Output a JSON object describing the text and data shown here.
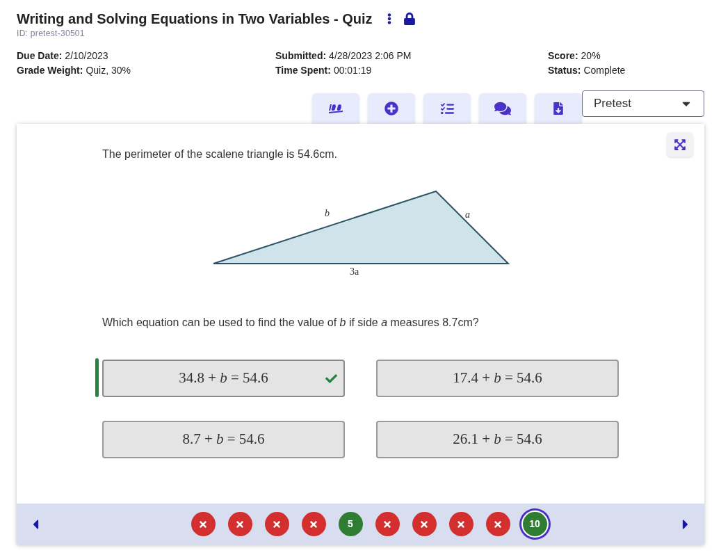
{
  "header": {
    "title": "Writing and Solving Equations in Two Variables - Quiz",
    "id": "ID: pretest-30501"
  },
  "info": [
    [
      {
        "label": "Due Date:",
        "value": "2/10/2023"
      },
      {
        "label": "Grade Weight:",
        "value": "Quiz, 30%"
      }
    ],
    [
      {
        "label": "Submitted:",
        "value": "4/28/2023 2:06 PM"
      },
      {
        "label": "Time Spent:",
        "value": "00:01:19"
      }
    ],
    [
      {
        "label": "Score:",
        "value": "20%"
      },
      {
        "label": "Status:",
        "value": "Complete"
      }
    ]
  ],
  "toolbar": [
    {
      "kind": "score"
    },
    {
      "kind": "add"
    },
    {
      "kind": "checklist"
    },
    {
      "kind": "comments"
    },
    {
      "kind": "download"
    }
  ],
  "dropdown": {
    "value": "Pretest"
  },
  "question": {
    "prompt": "The perimeter of the scalene triangle is 54.6cm.",
    "diagram_labels": {
      "left": "*b*",
      "right": "*a*",
      "base": "3a"
    },
    "ask": "Which equation can be used to find the value of *b* if side *a* measures 8.7cm?"
  },
  "choices": [
    {
      "text": "34.8 + *b* = 54.6",
      "selected": true,
      "correct": true
    },
    {
      "text": "17.4 + *b* = 54.6",
      "selected": false,
      "correct": false
    },
    {
      "text": "8.7 + *b* = 54.6",
      "selected": false,
      "correct": false
    },
    {
      "text": "26.1 + *b* = 54.6",
      "selected": false,
      "correct": false
    }
  ],
  "nav": [
    {
      "kind": "incorrect",
      "selected": false
    },
    {
      "kind": "incorrect",
      "selected": false
    },
    {
      "kind": "incorrect",
      "selected": false
    },
    {
      "kind": "incorrect",
      "selected": false
    },
    {
      "kind": "correct",
      "label": "5",
      "selected": false
    },
    {
      "kind": "incorrect",
      "selected": false
    },
    {
      "kind": "incorrect",
      "selected": false
    },
    {
      "kind": "incorrect",
      "selected": false
    },
    {
      "kind": "incorrect",
      "selected": false
    },
    {
      "kind": "correct",
      "label": "10",
      "selected": true
    }
  ]
}
